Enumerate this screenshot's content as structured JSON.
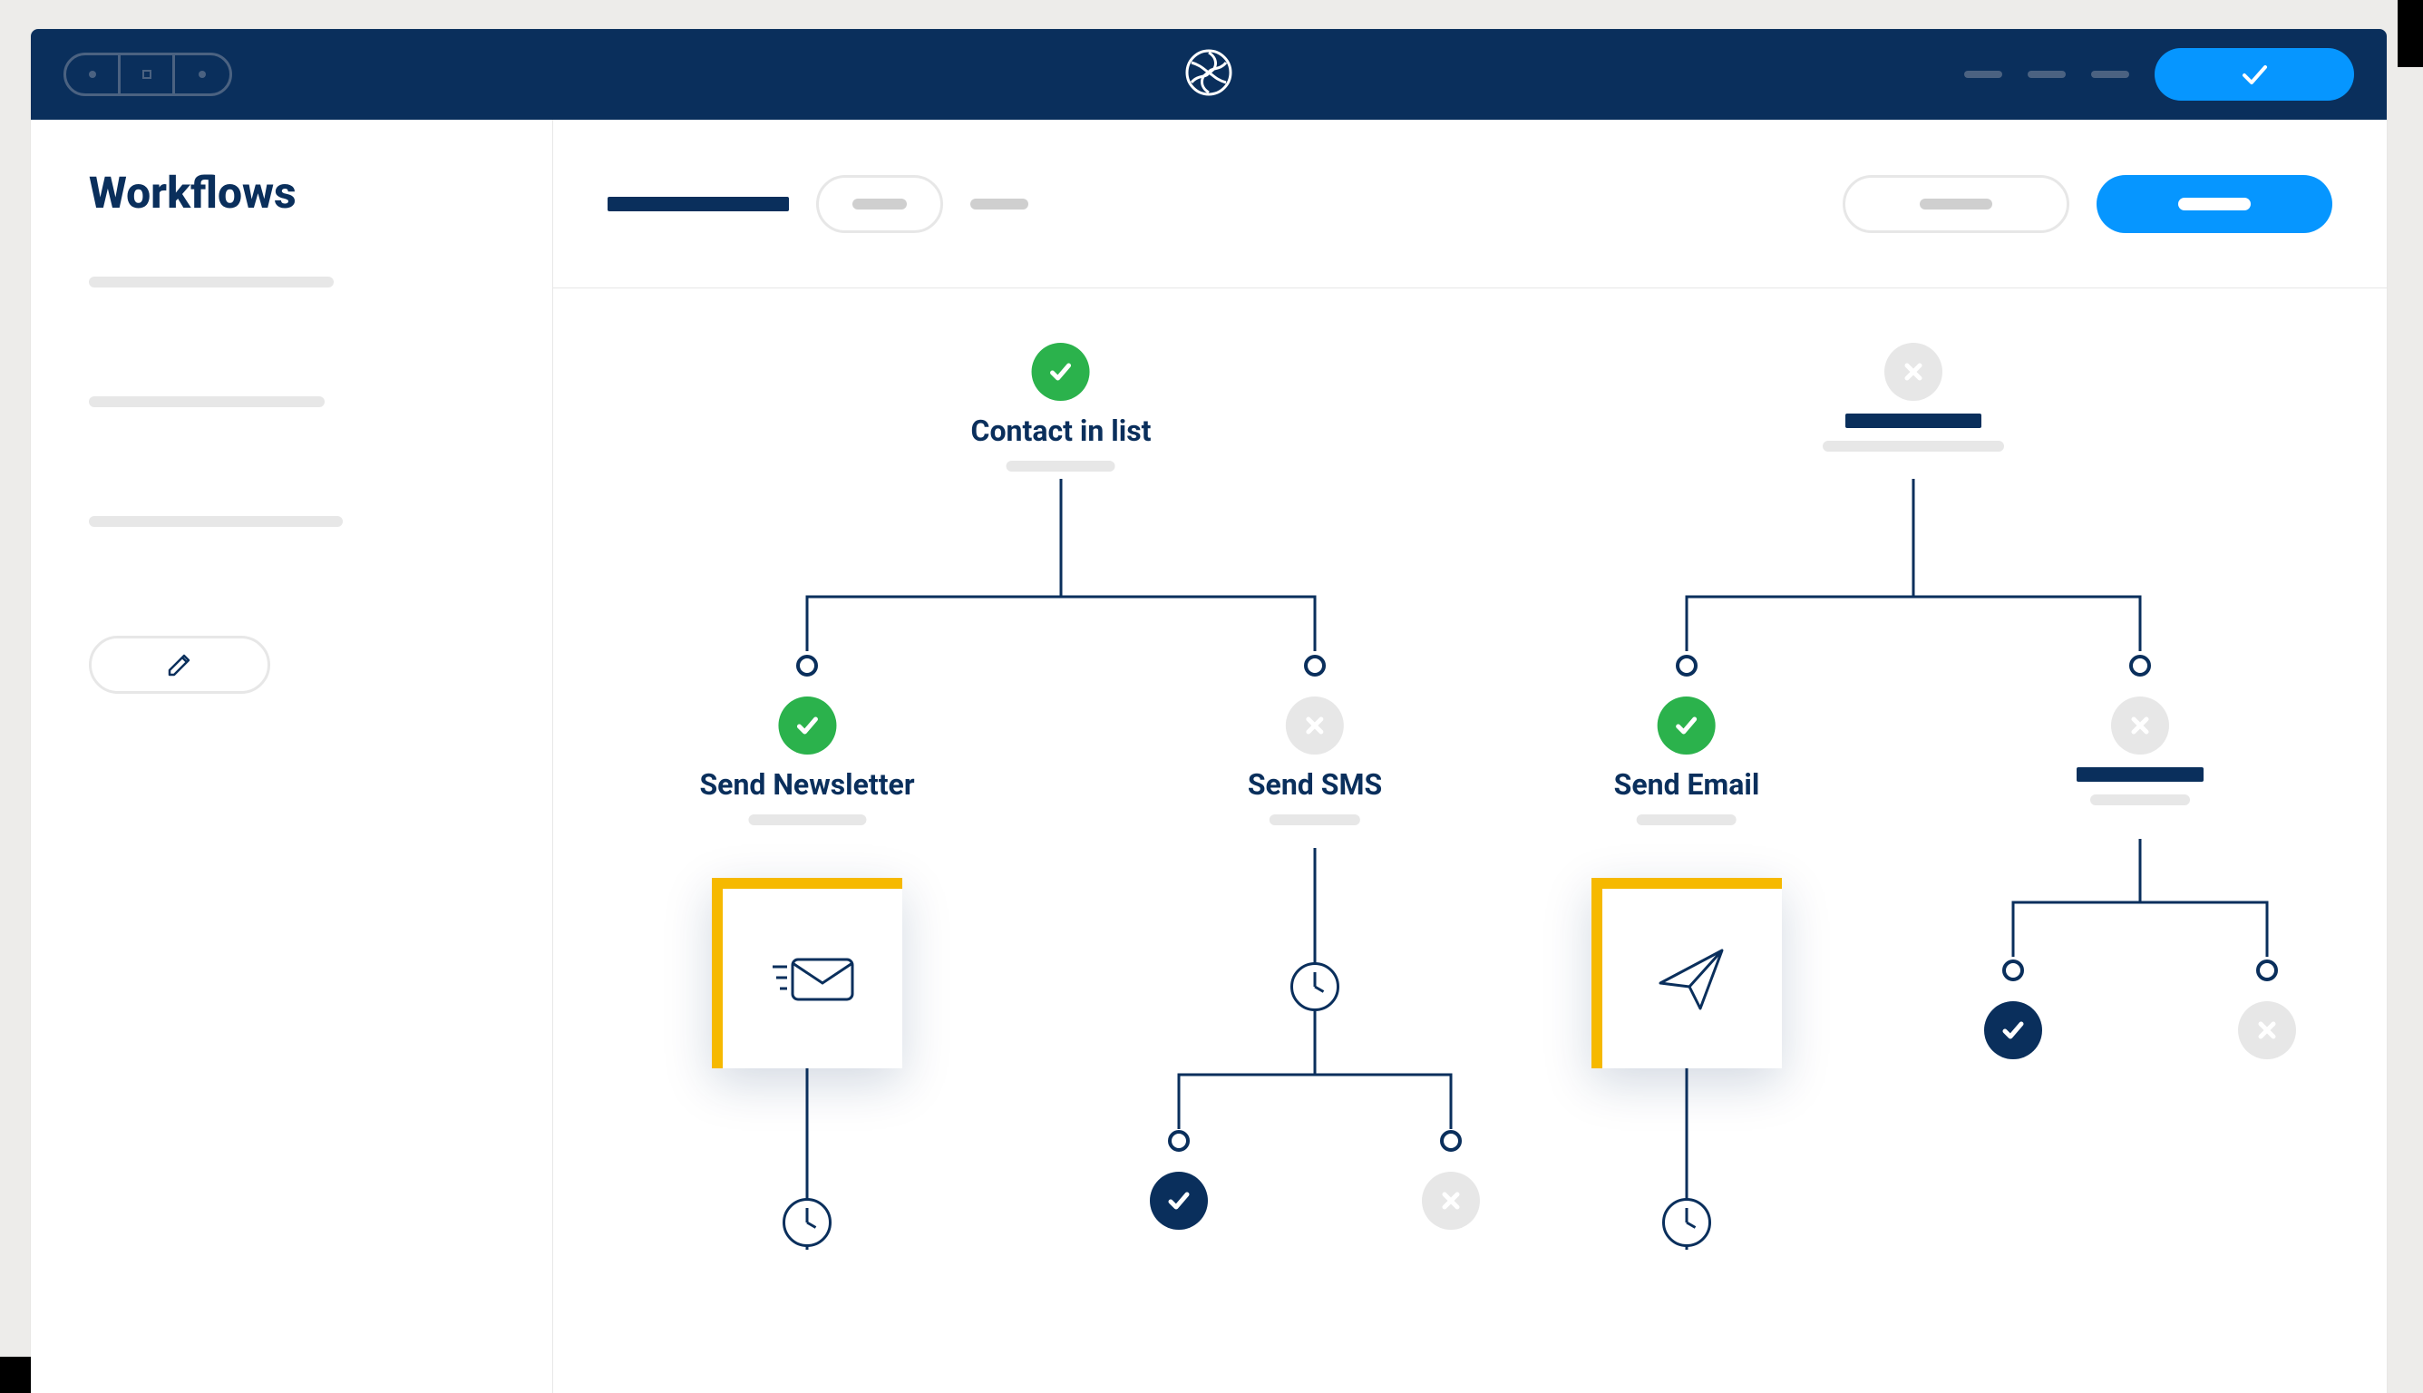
{
  "sidebar": {
    "title": "Workflows"
  },
  "nodes": {
    "root": {
      "label": "Contact in list"
    },
    "n1": {
      "label": "Send Newsletter"
    },
    "n2": {
      "label": "Send SMS"
    },
    "n3": {
      "label": "Send Email"
    }
  },
  "colors": {
    "navy": "#0a2f5c",
    "blue": "#0696ff",
    "green": "#2bb24c",
    "yellow": "#f6b900",
    "grey": "#e7e7e7"
  }
}
